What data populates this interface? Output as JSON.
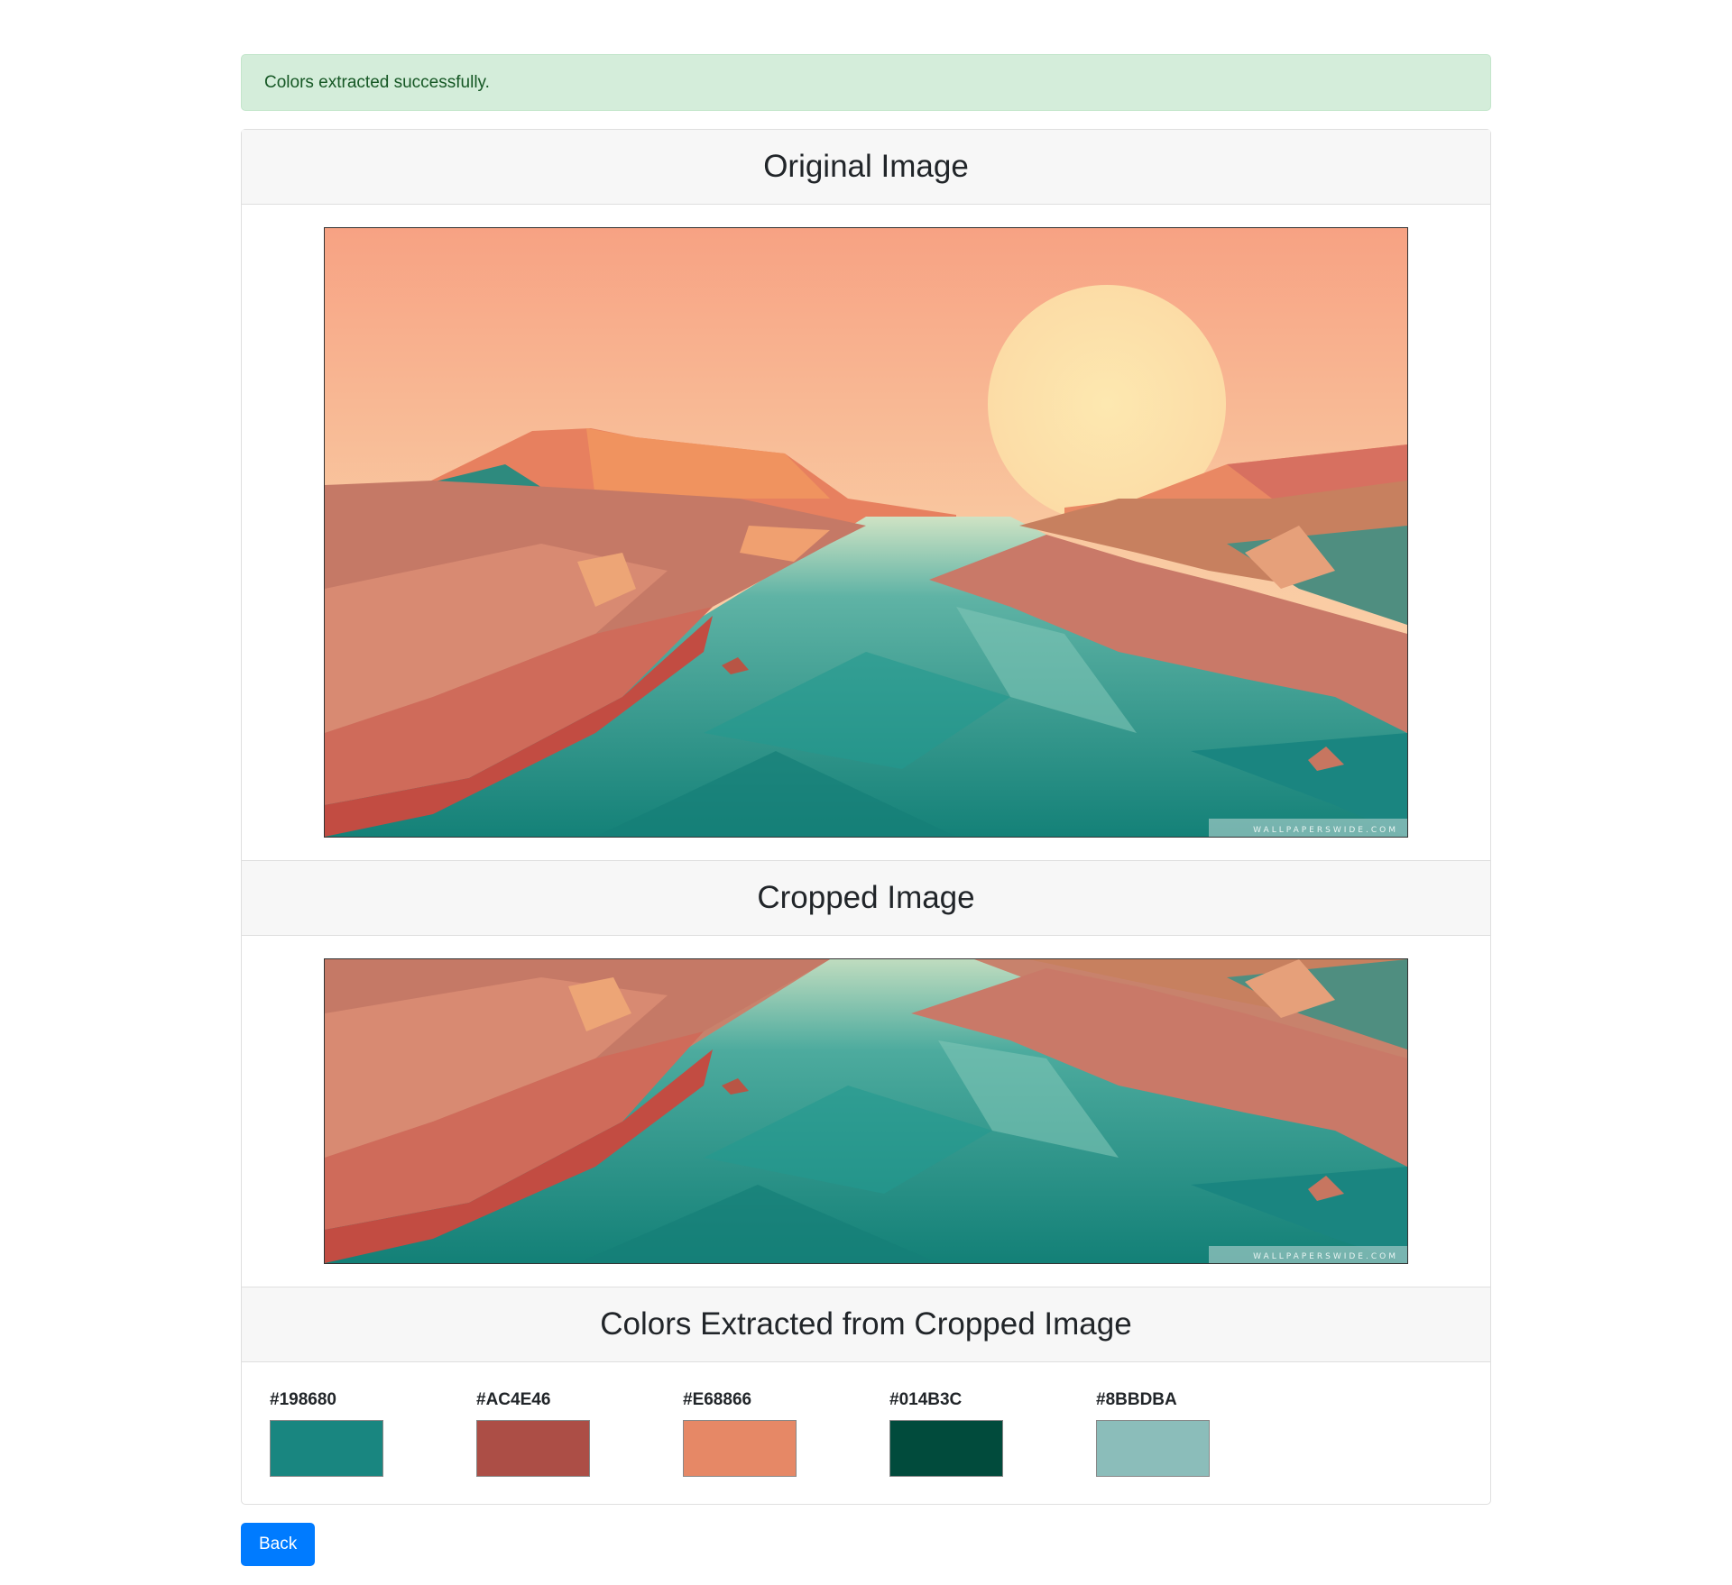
{
  "alert": {
    "message": "Colors extracted successfully."
  },
  "sections": {
    "original": {
      "title": "Original Image",
      "watermark": "WALLPAPERSWIDE.COM"
    },
    "cropped": {
      "title": "Cropped Image",
      "watermark": "WALLPAPERSWIDE.COM"
    },
    "colors": {
      "title": "Colors Extracted from Cropped Image"
    }
  },
  "colors": [
    {
      "hex": "#198680",
      "color": "#198680"
    },
    {
      "hex": "#AC4E46",
      "color": "#AC4E46"
    },
    {
      "hex": "#E68866",
      "color": "#E68866"
    },
    {
      "hex": "#014B3C",
      "color": "#014B3C"
    },
    {
      "hex": "#8BBDBA",
      "color": "#8BBDBA"
    }
  ],
  "back_button": {
    "label": "Back"
  }
}
